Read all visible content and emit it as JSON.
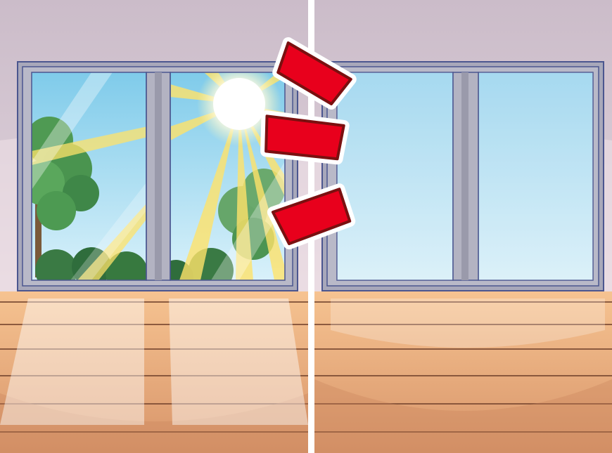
{
  "scene": {
    "panels": [
      {
        "name": "left-panel",
        "window_state": "sunny",
        "description_hidden": true
      },
      {
        "name": "right-panel",
        "window_state": "frosted"
      }
    ],
    "colors": {
      "wall": "#cdbfcb",
      "wall_lower": "#ecdee4",
      "frame_outer": "#a7a7b8",
      "frame_border": "#4b568f",
      "mullion": "#9a9aa9",
      "sky": "#bfe6f6",
      "tree_light": "#5fa05a",
      "tree_dark": "#3a7a44",
      "sun": "#ffffff",
      "sunray": "#ffe36a",
      "floor_light": "#f5c79a",
      "floor_dark": "#de9f72",
      "plank_line": "#7b4a33",
      "divider": "#ffffff",
      "alert_fill": "#e8001c",
      "alert_stroke": "#7a1010"
    },
    "icons": [
      "alert-marks-icon",
      "sun-icon",
      "tree-icon"
    ]
  }
}
